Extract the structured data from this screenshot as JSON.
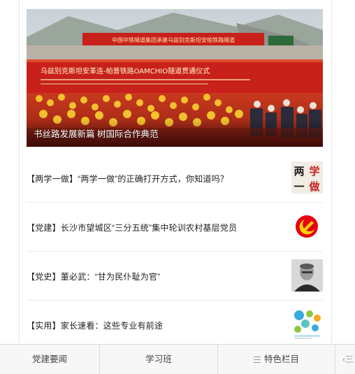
{
  "hero": {
    "caption": "书丝路发展新篇 树国际合作典范",
    "banner_text": "乌兹别克斯坦安革连-帕普铁路OAMCHIO隧道贯通仪式",
    "top_banner_text": "中国中铁隧道集团承建乌兹别克斯坦安帕铁路隧道",
    "colors": {
      "sky": "#cfd8de",
      "banner": "#c8201b",
      "crowd": "#d9461e",
      "helmet": "#f2c12e"
    }
  },
  "articles": [
    {
      "title": "【两学一做】“两学一做”的正确打开方式，你知道吗？",
      "thumb_icon": "liangxue-yizuo-thumb",
      "thumb_text_1": "两",
      "thumb_text_2": "学",
      "thumb_text_3": "一",
      "thumb_text_4": "做"
    },
    {
      "title": "【党建】长沙市望城区“三分五统”集中轮训农村基层党员",
      "thumb_icon": "party-emblem-thumb"
    },
    {
      "title": "【党史】董必武：“甘为民仆耻为官”",
      "thumb_icon": "portrait-thumb"
    },
    {
      "title": "【实用】家长速看：这些专业有前途",
      "thumb_icon": "infographic-thumb"
    }
  ],
  "bottom_nav": {
    "tab1": "党建要闻",
    "tab2": "学习班",
    "tab3": "特色栏目",
    "more": "‹三"
  }
}
